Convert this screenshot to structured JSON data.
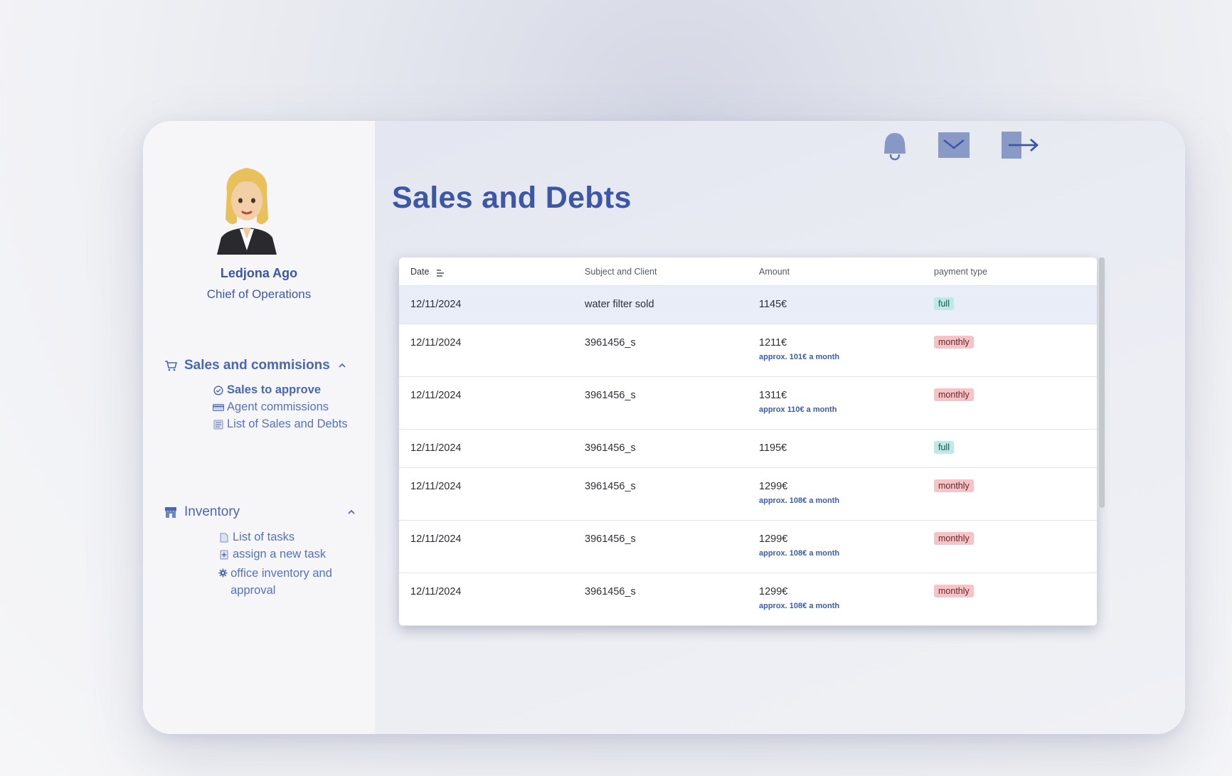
{
  "profile": {
    "name": "Ledjona Ago",
    "role": "Chief of Operations"
  },
  "sidebar": {
    "sections": [
      {
        "label": "Sales and commisions",
        "icon": "cart-icon",
        "expanded": true,
        "items": [
          {
            "label": "Sales to approve",
            "icon": "check-circle-icon",
            "active": true
          },
          {
            "label": "Agent commissions",
            "icon": "credit-card-icon"
          },
          {
            "label": "List of Sales and Debts",
            "icon": "ledger-icon"
          }
        ]
      },
      {
        "label": "Inventory",
        "icon": "store-icon",
        "expanded": true,
        "items": [
          {
            "label": "List of tasks",
            "icon": "document-icon"
          },
          {
            "label": "assign a new task",
            "icon": "plus-document-icon"
          },
          {
            "label": "office inventory and approval",
            "icon": "gear-icon"
          }
        ]
      }
    ]
  },
  "header": {
    "title": "Sales and Debts",
    "icons": [
      "bell-icon",
      "mail-icon",
      "logout-icon"
    ]
  },
  "table": {
    "columns": [
      "Date",
      "Subject and Client",
      "Amount",
      "payment type"
    ],
    "rows": [
      {
        "date": "12/11/2024",
        "subject": "water filter sold",
        "amount": "1145€",
        "note": "",
        "type": "full"
      },
      {
        "date": "12/11/2024",
        "subject": "3961456_s",
        "amount": "1211€",
        "note": "approx. 101€ a month",
        "type": "monthly"
      },
      {
        "date": "12/11/2024",
        "subject": "3961456_s",
        "amount": "1311€",
        "note": "approx 110€ a month",
        "type": "monthly"
      },
      {
        "date": "12/11/2024",
        "subject": "3961456_s",
        "amount": "1195€",
        "note": "",
        "type": "full"
      },
      {
        "date": "12/11/2024",
        "subject": "3961456_s",
        "amount": "1299€",
        "note": "approx. 108€ a month",
        "type": "monthly"
      },
      {
        "date": "12/11/2024",
        "subject": "3961456_s",
        "amount": "1299€",
        "note": "approx. 108€ a month",
        "type": "monthly"
      },
      {
        "date": "12/11/2024",
        "subject": "3961456_s",
        "amount": "1299€",
        "note": "approx. 108€ a month",
        "type": "monthly"
      }
    ]
  },
  "colors": {
    "accent": "#3d57a5",
    "badge_full": "#bde9e6",
    "badge_monthly": "#f8c3c6",
    "highlight_row": "#e9edf8"
  }
}
